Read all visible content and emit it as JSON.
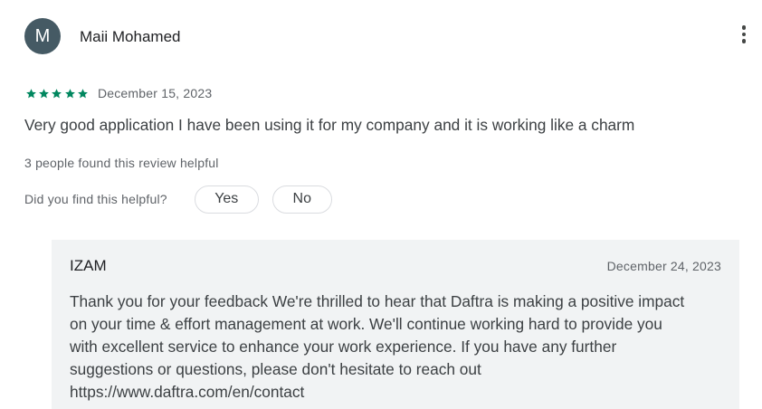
{
  "review": {
    "avatar_initial": "M",
    "reviewer_name": "Maii Mohamed",
    "rating": 5,
    "rating_color": "#01875f",
    "date": "December 15, 2023",
    "text": "Very good application I have been using it for my company and it is working like a charm",
    "helpful_count_text": "3 people found this review helpful",
    "more_options_icon": "more-vert-icon"
  },
  "feedback": {
    "question": "Did you find this helpful?",
    "yes_label": "Yes",
    "no_label": "No"
  },
  "developer_reply": {
    "name": "IZAM",
    "date": "December 24, 2023",
    "lines": [
      "Thank you for your feedback We're thrilled to hear that Daftra is making a positive impact",
      "on your time & effort management at work. We'll continue working hard to provide you",
      "with excellent service to enhance your work experience. If you have any further",
      "suggestions or questions, please don't hesitate to reach out",
      "https://www.daftra.com/en/contact"
    ]
  },
  "colors": {
    "avatar_bg": "#455a64",
    "reply_bg": "#f1f3f4",
    "star": "#01875f"
  }
}
